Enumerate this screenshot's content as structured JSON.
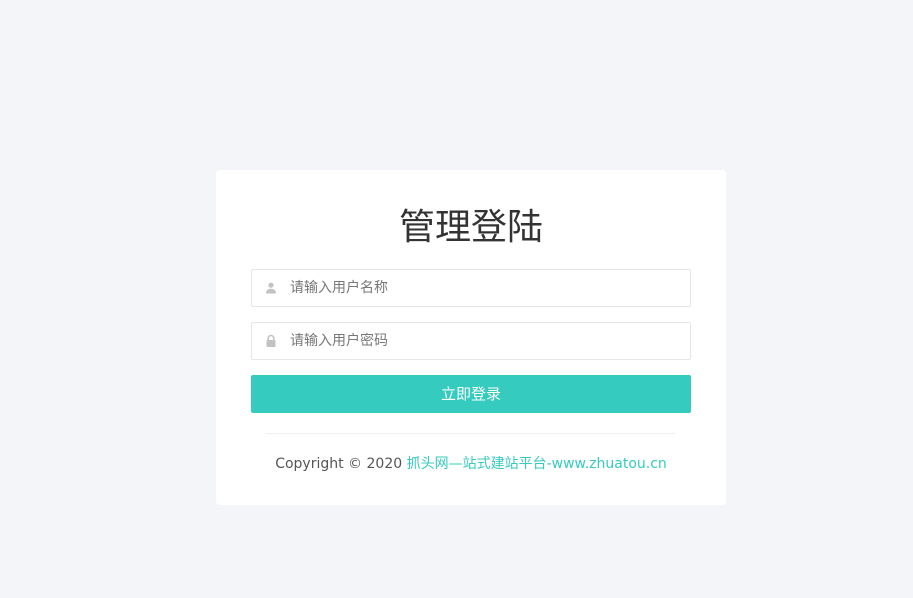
{
  "login": {
    "title": "管理登陆",
    "username": {
      "placeholder": "请输入用户名称",
      "value": "",
      "icon": "user-icon"
    },
    "password": {
      "placeholder": "请输入用户密码",
      "value": "",
      "icon": "lock-icon"
    },
    "submit_label": "立即登录"
  },
  "footer": {
    "copyright": "Copyright © 2020 ",
    "link_text": "抓头网—站式建站平台-www.zhuatou.cn"
  },
  "colors": {
    "background": "#f4f5f9",
    "card": "#ffffff",
    "accent": "#35cbbe",
    "title": "#333333",
    "icon": "#c2c2c2"
  }
}
